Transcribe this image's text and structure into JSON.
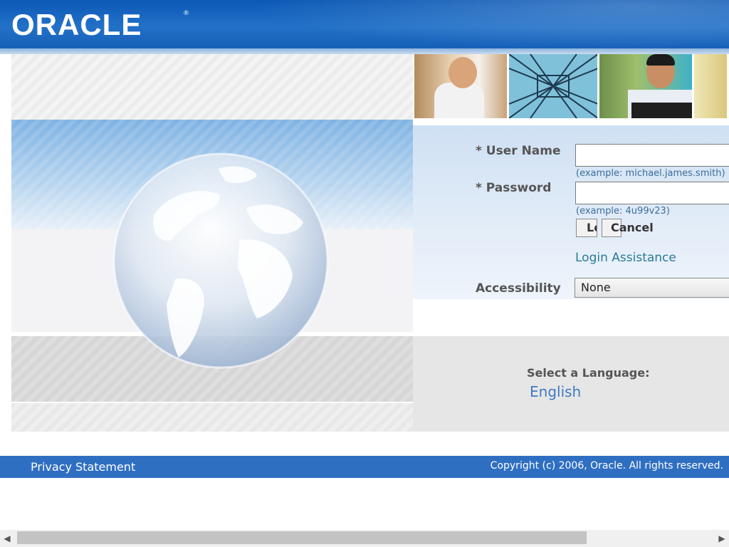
{
  "header": {
    "logo": "ORACLE",
    "logo_mark": "®"
  },
  "login": {
    "username_label": "* User Name",
    "username_value": "",
    "username_hint": "(example: michael.james.smith)",
    "password_label": "* Password",
    "password_value": "",
    "password_hint": "(example: 4u99v23)",
    "login_button": "Login",
    "cancel_button": "Cancel",
    "assistance_link": "Login Assistance",
    "accessibility_label": "Accessibility",
    "accessibility_value": "None"
  },
  "language": {
    "label": "Select a Language:",
    "selected": "English"
  },
  "footer": {
    "privacy": "Privacy Statement",
    "copyright": "Copyright (c) 2006, Oracle. All rights reserved."
  },
  "icons": {
    "scroll_left": "scroll-left-arrow-icon",
    "scroll_right": "scroll-right-arrow-icon"
  },
  "colors": {
    "header_blue": "#1a62bd",
    "footer_blue": "#2f6fc2",
    "link_teal": "#2b7a9a",
    "language_link": "#3f7bc6"
  }
}
